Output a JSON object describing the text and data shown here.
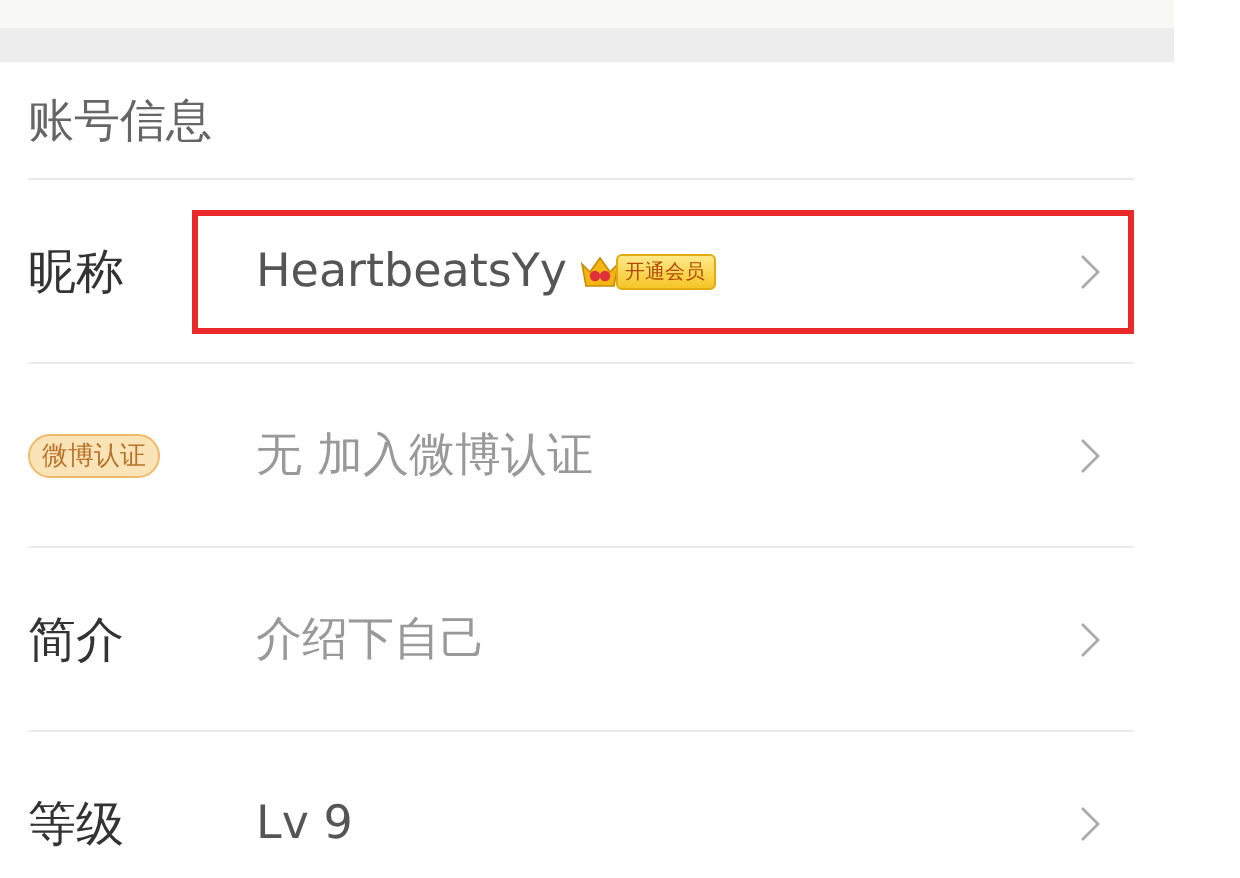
{
  "section": {
    "title": "账号信息"
  },
  "rows": [
    {
      "kind": "text",
      "label": "昵称",
      "value": "HeartbeatsYy",
      "dimmed": false,
      "vip_badge": "开通会员",
      "highlighted": true
    },
    {
      "kind": "badge",
      "label": "微博认证",
      "value": "无 加入微博认证",
      "dimmed": true,
      "highlighted": false
    },
    {
      "kind": "text",
      "label": "简介",
      "value": "介绍下自己",
      "dimmed": true,
      "highlighted": false
    },
    {
      "kind": "text",
      "label": "等级",
      "value": "Lv 9",
      "dimmed": false,
      "highlighted": false
    }
  ]
}
